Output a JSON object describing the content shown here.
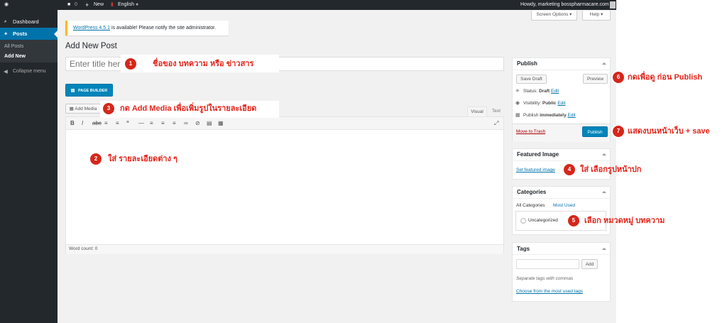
{
  "adminbar": {
    "comments_count": "0",
    "new_label": "New",
    "language_label": "English",
    "howdy": "Howdy, marketing bosspharmacare.com"
  },
  "sidebar": {
    "dashboard": "Dashboard",
    "posts": "Posts",
    "all_posts": "All Posts",
    "add_new": "Add New",
    "collapse": "Collapse menu"
  },
  "header": {
    "screen_options": "Screen Options",
    "help": "Help",
    "notice_link": "WordPress 4.5.1",
    "notice_text": " is available! Please notify the site administrator.",
    "page_title": "Add New Post"
  },
  "editor": {
    "title_placeholder": "Enter title here",
    "page_builder": "PAGE BUILDER",
    "add_media": "Add Media",
    "tab_visual": "Visual",
    "tab_text": "Text",
    "word_count": "Word count: 0"
  },
  "publish": {
    "title": "Publish",
    "save_draft": "Save Draft",
    "preview": "Preview",
    "status_label": "Status: ",
    "status_value": "Draft",
    "visibility_label": "Visibility: ",
    "visibility_value": "Public",
    "publish_label": "Publish ",
    "publish_value": "immediately",
    "edit": "Edit",
    "move_to_trash": "Move to Trash",
    "publish_button": "Publish"
  },
  "featured": {
    "title": "Featured Image",
    "set_link": "Set featured image"
  },
  "categories": {
    "title": "Categories",
    "tab_all": "All Categories",
    "tab_used": "Most Used",
    "uncategorized": "Uncategorized"
  },
  "tags": {
    "title": "Tags",
    "add": "Add",
    "hint": "Separate tags with commas",
    "choose": "Choose from the most used tags"
  },
  "annotations": [
    {
      "num": "1",
      "text": "ชื่อของ บทความ หรือ ข่าวสาร"
    },
    {
      "num": "2",
      "text": "ใส่ รายละเอียดต่าง ๆ"
    },
    {
      "num": "3",
      "text": "กด Add Media เพื่อเพิ่มรูปในรายละเอียด"
    },
    {
      "num": "4",
      "text": "ใส่ เลือกรูปหน้าปก"
    },
    {
      "num": "5",
      "text": "เลือก หมวดหมู่ บทความ"
    },
    {
      "num": "6",
      "text": "กดเพื่อดู ก่อน Publish"
    },
    {
      "num": "7",
      "text": "แสดงบนหน้าเว็บ + save"
    }
  ]
}
